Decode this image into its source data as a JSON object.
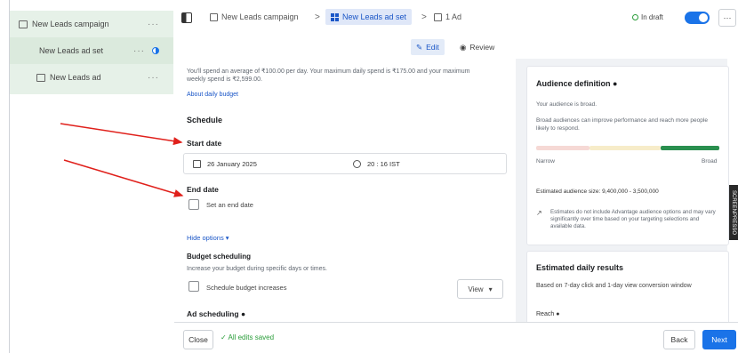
{
  "sidebar": {
    "items": [
      {
        "label": "New Leads campaign"
      },
      {
        "label": "New Leads ad set"
      },
      {
        "label": "New Leads ad"
      }
    ],
    "more": "···"
  },
  "header": {
    "crumbs": {
      "campaign": "New Leads campaign",
      "adset": "New Leads ad set",
      "ad": "1 Ad"
    },
    "separator": ">",
    "status": "In draft",
    "more": "···"
  },
  "tabs": {
    "edit": "Edit",
    "review": "Review"
  },
  "budget": {
    "notice_line1": "You'll spend an average of ₹100.00 per day. Your maximum daily spend is ₹175.00 and your maximum",
    "notice_line2": "weekly spend is ₹2,599.00.",
    "about_link": "About daily budget"
  },
  "schedule": {
    "heading": "Schedule",
    "start_label": "Start date",
    "start_date": "26 January 2025",
    "start_time": "20 : 16   IST",
    "end_label": "End date",
    "end_checkbox": "Set an end date",
    "hide_options": "Hide options ▾",
    "budget_sched_heading": "Budget scheduling",
    "budget_sched_desc": "Increase your budget during specific days or times.",
    "budget_sched_checkbox": "Schedule budget increases",
    "view_label": "View",
    "ad_sched_heading": "Ad scheduling"
  },
  "audience": {
    "title": "Audience definition",
    "selected": "Your audience is broad.",
    "desc": "Broad audiences can improve performance and reach more people likely to respond.",
    "narrow": "Narrow",
    "broad": "Broad",
    "estimated": "Estimated audience size: 9,400,000 - 3,500,000",
    "note": "Estimates do not include Advantage audience options and may vary significantly over time based on your targeting selections and available data."
  },
  "daily": {
    "title": "Estimated daily results",
    "desc": "Based on 7-day click and 1-day view conversion window",
    "reach": "Reach"
  },
  "footer": {
    "close": "Close",
    "saved": "All edits saved",
    "back": "Back",
    "next": "Next"
  },
  "side_tab": "SCREENPRESSO",
  "colors": {
    "accent": "#1a73e8",
    "arrow": "#e0201b",
    "sidebar_bg": "#e6f1e8",
    "meter_green": "#2a8f4f"
  }
}
